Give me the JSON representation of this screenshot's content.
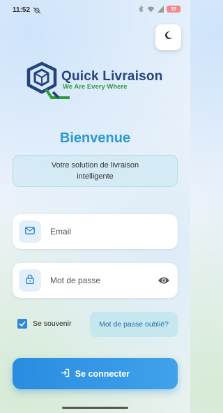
{
  "status_bar": {
    "time": "11:52",
    "battery": "15"
  },
  "header": {
    "theme_toggle_icon": "moon-icon"
  },
  "logo": {
    "title": "Quick Livraison",
    "tagline": "We Are Every Where",
    "colors": {
      "title": "#25447c",
      "tagline": "#2f9e3a"
    }
  },
  "welcome": {
    "title": "Bienvenue",
    "subtitle": "Votre solution de livraison intelligente"
  },
  "form": {
    "email_placeholder": "Email",
    "password_placeholder": "Mot de passe",
    "remember_label": "Se souvenir",
    "remember_checked": true,
    "forgot_label": "Mot de passe oublié?",
    "submit_label": "Se connecter"
  },
  "colors": {
    "accent": "#2a9ad1",
    "button": "#2f8fe0"
  }
}
